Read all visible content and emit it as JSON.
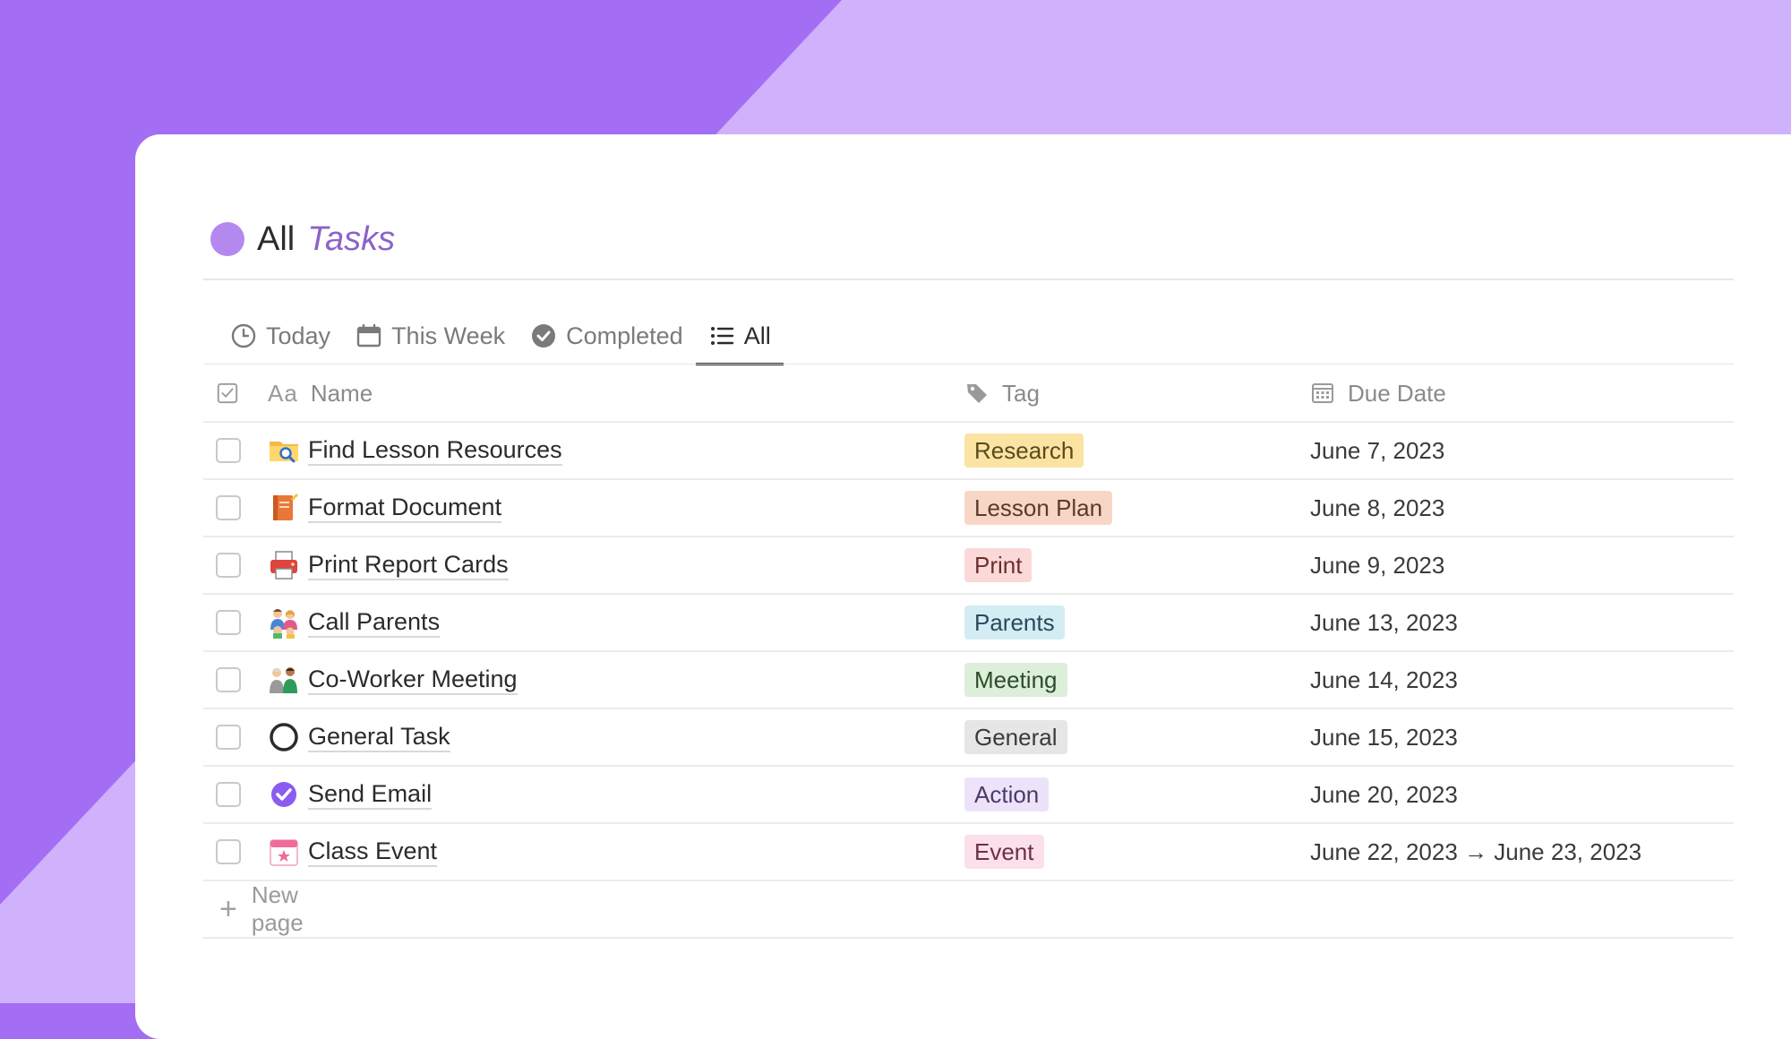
{
  "colors": {
    "accent": "#b388ef",
    "title_accent": "#8a63c9",
    "bg_dark": "#a46ef4",
    "bg_light": "#d0b1fc"
  },
  "header": {
    "title_plain": "All",
    "title_accent": "Tasks"
  },
  "tabs": [
    {
      "label": "Today",
      "icon": "clock-icon",
      "active": false
    },
    {
      "label": "This Week",
      "icon": "calendar-icon",
      "active": false
    },
    {
      "label": "Completed",
      "icon": "check-circle-icon",
      "active": false
    },
    {
      "label": "All",
      "icon": "list-icon",
      "active": true
    }
  ],
  "table": {
    "columns": {
      "name": "Name",
      "name_prefix": "Aa",
      "tag": "Tag",
      "due_date": "Due Date"
    },
    "rows": [
      {
        "name": "Find Lesson Resources",
        "icon": "folder-search-icon",
        "tag": "Research",
        "tag_bg": "#fbe3a3",
        "tag_color": "#5a4a1c",
        "due": "June 7, 2023",
        "done": false
      },
      {
        "name": "Format Document",
        "icon": "notebook-icon",
        "tag": "Lesson Plan",
        "tag_bg": "#f8d6c5",
        "tag_color": "#5b3a2a",
        "due": "June 8, 2023",
        "done": false
      },
      {
        "name": "Print Report Cards",
        "icon": "printer-icon",
        "tag": "Print",
        "tag_bg": "#fbd9d8",
        "tag_color": "#6b2f2c",
        "due": "June 9, 2023",
        "done": false
      },
      {
        "name": "Call Parents",
        "icon": "parents-icon",
        "tag": "Parents",
        "tag_bg": "#d4ecf4",
        "tag_color": "#2a4a5a",
        "due": "June 13, 2023",
        "done": false
      },
      {
        "name": "Co-Worker Meeting",
        "icon": "coworkers-icon",
        "tag": "Meeting",
        "tag_bg": "#dcefd9",
        "tag_color": "#2f4a2c",
        "due": "June 14, 2023",
        "done": false
      },
      {
        "name": "General Task",
        "icon": "circle-outline-icon",
        "tag": "General",
        "tag_bg": "#e6e6e6",
        "tag_color": "#3a3a3a",
        "due": "June 15, 2023",
        "done": false
      },
      {
        "name": "Send Email",
        "icon": "purple-check-icon",
        "tag": "Action",
        "tag_bg": "#ece3f9",
        "tag_color": "#4b3a6a",
        "due": "June 20, 2023",
        "done": false
      },
      {
        "name": "Class Event",
        "icon": "calendar-star-icon",
        "tag": "Event",
        "tag_bg": "#fbe0ec",
        "tag_color": "#6b2f4a",
        "due": "June 22, 2023 → June 23, 2023",
        "done": false
      }
    ],
    "new_page_label": "New page"
  }
}
